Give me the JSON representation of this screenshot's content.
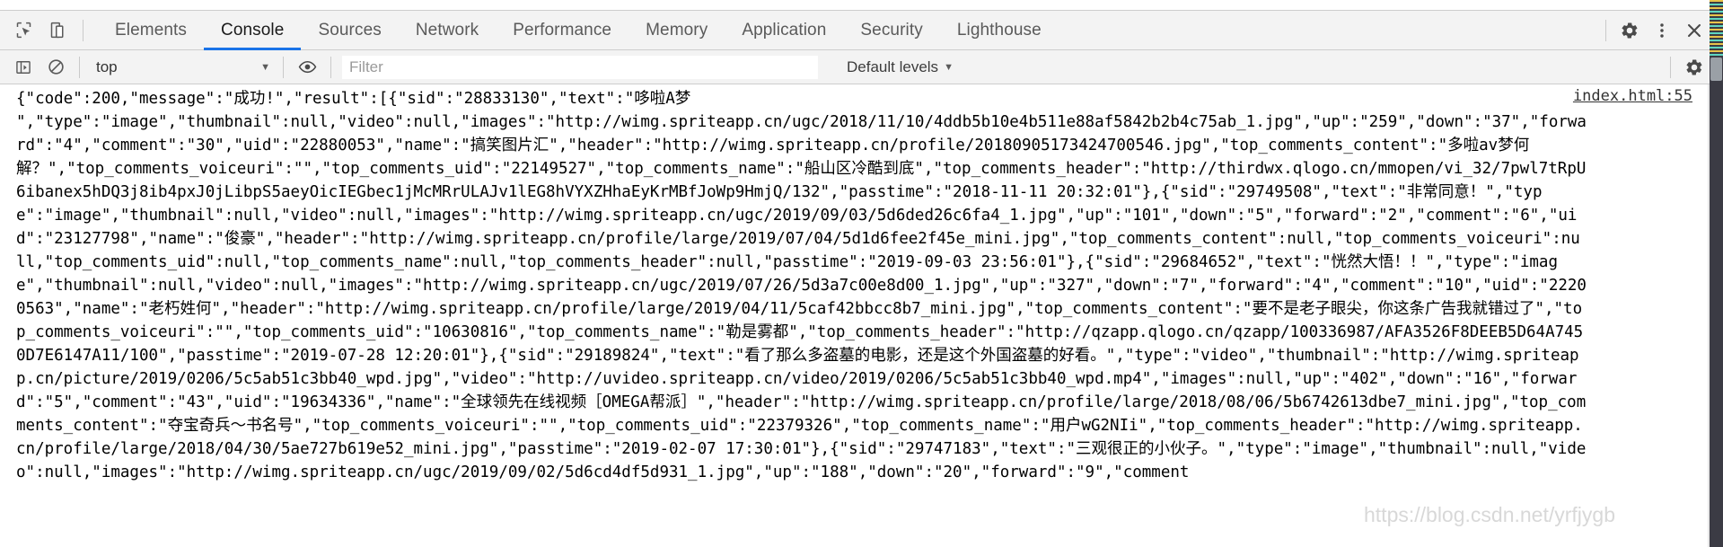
{
  "window": {
    "title": "Chrome DevTools"
  },
  "toolbar": {
    "icons": {
      "inspect": "inspect-element-icon",
      "device": "device-toolbar-icon",
      "settings": "gear-icon",
      "more": "more-options-icon",
      "close": "close-icon"
    },
    "tabs": [
      {
        "label": "Elements",
        "active": false
      },
      {
        "label": "Console",
        "active": true
      },
      {
        "label": "Sources",
        "active": false
      },
      {
        "label": "Network",
        "active": false
      },
      {
        "label": "Performance",
        "active": false
      },
      {
        "label": "Memory",
        "active": false
      },
      {
        "label": "Application",
        "active": false
      },
      {
        "label": "Security",
        "active": false
      },
      {
        "label": "Lighthouse",
        "active": false
      }
    ]
  },
  "console_bar": {
    "sidebar_toggle_icon": "show-console-sidebar-icon",
    "clear_icon": "clear-console-icon",
    "context": "top",
    "context_caret": "▼",
    "eye_icon": "live-expression-icon",
    "filter_value": "",
    "filter_placeholder": "Filter",
    "levels_label": "Default levels",
    "levels_caret": "▼",
    "settings_icon": "gear-icon"
  },
  "console": {
    "messages": [
      {
        "source_link": "index.html:55",
        "text": "{\"code\":200,\"message\":\"成功!\",\"result\":[{\"sid\":\"28833130\",\"text\":\"哆啦A梦\n\",\"type\":\"image\",\"thumbnail\":null,\"video\":null,\"images\":\"http://wimg.spriteapp.cn/ugc/2018/11/10/4ddb5b10e4b511e88af5842b2b4c75ab_1.jpg\",\"up\":\"259\",\"down\":\"37\",\"forward\":\"4\",\"comment\":\"30\",\"uid\":\"22880053\",\"name\":\"搞笑图片汇\",\"header\":\"http://wimg.spriteapp.cn/profile/20180905173424700546.jpg\",\"top_comments_content\":\"多啦av梦何解？\",\"top_comments_voiceuri\":\"\",\"top_comments_uid\":\"22149527\",\"top_comments_name\":\"船山区冷酷到底\",\"top_comments_header\":\"http://thirdwx.qlogo.cn/mmopen/vi_32/7pwl7tRpU6ibanex5hDQ3j8ib4pxJ0jLibpS5aeyOicIEGbec1jMcMRrULAJv1lEG8hVYXZHhaEyKrMBfJoWp9HmjQ/132\",\"passtime\":\"2018-11-11 20:32:01\"},{\"sid\":\"29749508\",\"text\":\"非常同意！\",\"type\":\"image\",\"thumbnail\":null,\"video\":null,\"images\":\"http://wimg.spriteapp.cn/ugc/2019/09/03/5d6ded26c6fa4_1.jpg\",\"up\":\"101\",\"down\":\"5\",\"forward\":\"2\",\"comment\":\"6\",\"uid\":\"23127798\",\"name\":\"俊豪\",\"header\":\"http://wimg.spriteapp.cn/profile/large/2019/07/04/5d1d6fee2f45e_mini.jpg\",\"top_comments_content\":null,\"top_comments_voiceuri\":null,\"top_comments_uid\":null,\"top_comments_name\":null,\"top_comments_header\":null,\"passtime\":\"2019-09-03 23:56:01\"},{\"sid\":\"29684652\",\"text\":\"恍然大悟！！\",\"type\":\"image\",\"thumbnail\":null,\"video\":null,\"images\":\"http://wimg.spriteapp.cn/ugc/2019/07/26/5d3a7c00e8d00_1.jpg\",\"up\":\"327\",\"down\":\"7\",\"forward\":\"4\",\"comment\":\"10\",\"uid\":\"22200563\",\"name\":\"老朽姓何\",\"header\":\"http://wimg.spriteapp.cn/profile/large/2019/04/11/5caf42bbcc8b7_mini.jpg\",\"top_comments_content\":\"要不是老子眼尖，你这条广告我就错过了\",\"top_comments_voiceuri\":\"\",\"top_comments_uid\":\"10630816\",\"top_comments_name\":\"勒是雾都\",\"top_comments_header\":\"http://qzapp.qlogo.cn/qzapp/100336987/AFA3526F8DEEB5D64A7450D7E6147A11/100\",\"passtime\":\"2019-07-28 12:20:01\"},{\"sid\":\"29189824\",\"text\":\"看了那么多盗墓的电影，还是这个外国盗墓的好看。\",\"type\":\"video\",\"thumbnail\":\"http://wimg.spriteapp.cn/picture/2019/0206/5c5ab51c3bb40_wpd.jpg\",\"video\":\"http://uvideo.spriteapp.cn/video/2019/0206/5c5ab51c3bb40_wpd.mp4\",\"images\":null,\"up\":\"402\",\"down\":\"16\",\"forward\":\"5\",\"comment\":\"43\",\"uid\":\"19634336\",\"name\":\"全球领先在线视频［OMEGA帮派］\",\"header\":\"http://wimg.spriteapp.cn/profile/large/2018/08/06/5b6742613dbe7_mini.jpg\",\"top_comments_content\":\"夺宝奇兵～书名号\",\"top_comments_voiceuri\":\"\",\"top_comments_uid\":\"22379326\",\"top_comments_name\":\"用户wG2NIi\",\"top_comments_header\":\"http://wimg.spriteapp.cn/profile/large/2018/04/30/5ae727b619e52_mini.jpg\",\"passtime\":\"2019-02-07 17:30:01\"},{\"sid\":\"29747183\",\"text\":\"三观很正的小伙子。\",\"type\":\"image\",\"thumbnail\":null,\"video\":null,\"images\":\"http://wimg.spriteapp.cn/ugc/2019/09/02/5d6cd4df5d931_1.jpg\",\"up\":\"188\",\"down\":\"20\",\"forward\":\"9\",\"comment"
      }
    ]
  },
  "scrollbar": {
    "up_arrow": "▲",
    "down_arrow": "▼"
  },
  "watermark": {
    "text": "https://blog.csdn.net/yrfjygb"
  }
}
